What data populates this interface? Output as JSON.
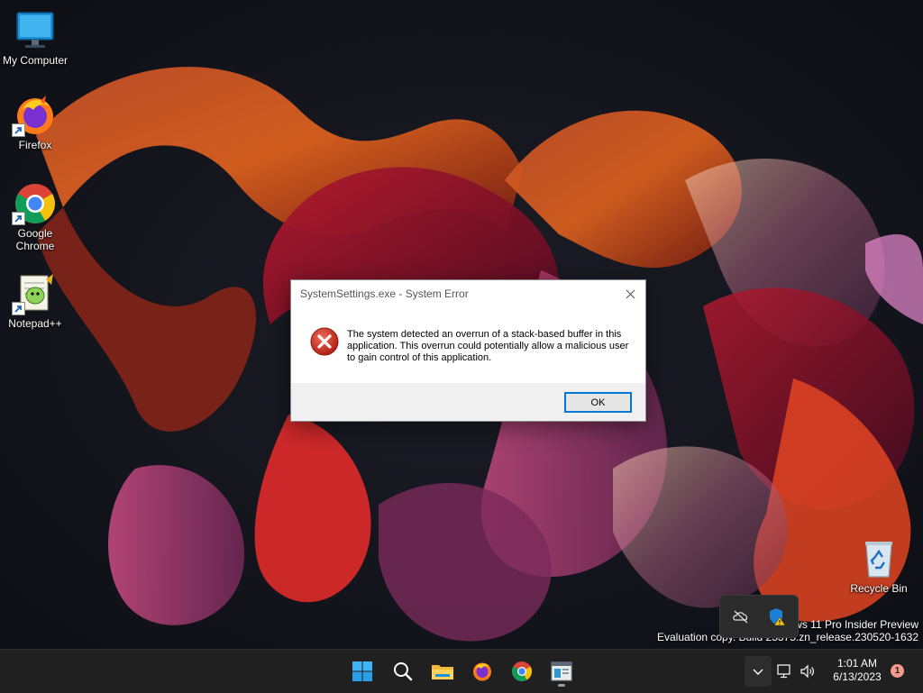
{
  "desktop": {
    "icons": [
      {
        "label": "My Computer",
        "icon": "monitor-icon"
      },
      {
        "label": "Firefox",
        "icon": "firefox-icon"
      },
      {
        "label": "Google Chrome",
        "icon": "chrome-icon"
      },
      {
        "label": "Notepad++",
        "icon": "notepadpp-icon"
      },
      {
        "label": "Recycle Bin",
        "icon": "recycle-bin-icon"
      }
    ],
    "watermark": {
      "line1": "ws 11 Pro Insider Preview",
      "line2": "Evaluation copy. Build 25375.zn_release.230520-1632"
    }
  },
  "dialog": {
    "title": "SystemSettings.exe - System Error",
    "message": "The system detected an overrun of a stack-based buffer in this application. This overrun could potentially allow a malicious user to gain control of this application.",
    "ok_label": "OK",
    "icon": "error-icon"
  },
  "tray_flyout": {
    "icons": [
      "onedrive-offline-icon",
      "defender-warning-icon"
    ]
  },
  "taskbar": {
    "apps": [
      "windows-start-icon",
      "search-icon",
      "file-explorer-icon",
      "firefox-icon",
      "chrome-icon",
      "settings-app-icon"
    ],
    "time": "1:01 AM",
    "date": "6/13/2023",
    "notification_count": "1"
  },
  "colors": {
    "accent": "#0078d4",
    "error": "#c42b1c",
    "taskbar": "#202020"
  }
}
